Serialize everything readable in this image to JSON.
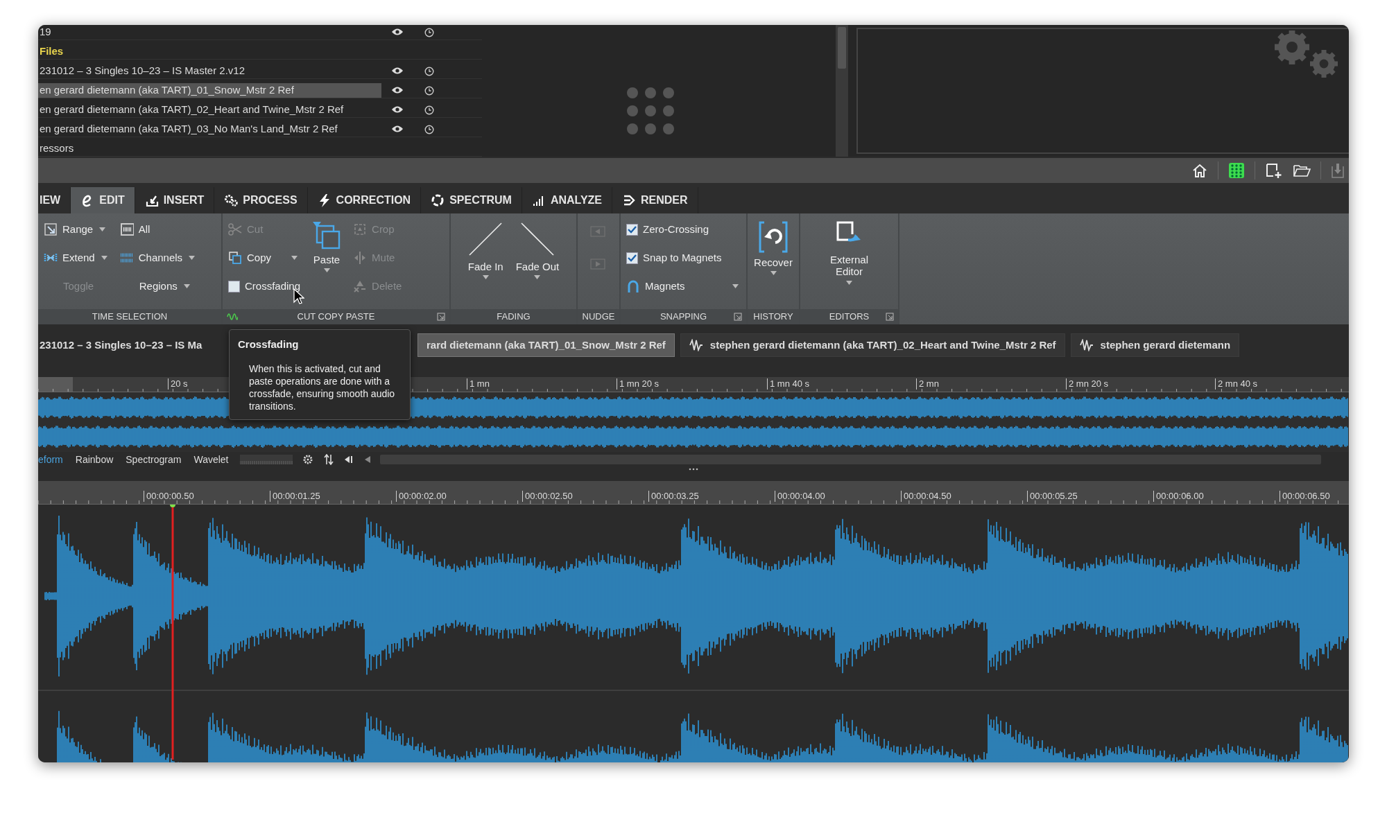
{
  "file_browser": {
    "rows": [
      {
        "kind": "file",
        "label": "19",
        "selected": false
      },
      {
        "kind": "heading",
        "label": "Files",
        "selected": false
      },
      {
        "kind": "file",
        "label": "231012 – 3 Singles 10–23 – IS Master 2.v12",
        "selected": false
      },
      {
        "kind": "file",
        "label": "en gerard dietemann (aka TART)_01_Snow_Mstr 2 Ref",
        "selected": true
      },
      {
        "kind": "file",
        "label": "en gerard dietemann (aka TART)_02_Heart and Twine_Mstr 2 Ref",
        "selected": false
      },
      {
        "kind": "file",
        "label": "en gerard dietemann (aka TART)_03_No Man's Land_Mstr 2 Ref",
        "selected": false
      },
      {
        "kind": "group",
        "label": "ressors",
        "selected": false
      }
    ]
  },
  "tabs": [
    {
      "label": "IEW",
      "selected": false
    },
    {
      "label": "EDIT",
      "selected": true
    },
    {
      "label": "INSERT",
      "selected": false
    },
    {
      "label": "PROCESS",
      "selected": false
    },
    {
      "label": "CORRECTION",
      "selected": false
    },
    {
      "label": "SPECTRUM",
      "selected": false
    },
    {
      "label": "ANALYZE",
      "selected": false
    },
    {
      "label": "RENDER",
      "selected": false
    }
  ],
  "ribbon": {
    "groups": [
      {
        "title": "TIME SELECTION",
        "columns": [
          [
            {
              "kind": "small",
              "label": "Range",
              "dropdown": true,
              "disabled": false
            },
            {
              "kind": "small",
              "label": "Extend",
              "dropdown": true,
              "disabled": false
            },
            {
              "kind": "small",
              "label": "Toggle",
              "dropdown": false,
              "disabled": true
            }
          ],
          [
            {
              "kind": "small",
              "label": "All",
              "dropdown": false,
              "disabled": false
            },
            {
              "kind": "small",
              "label": "Channels",
              "dropdown": true,
              "disabled": false
            },
            {
              "kind": "small",
              "label": "Regions",
              "dropdown": true,
              "disabled": false
            }
          ]
        ]
      },
      {
        "title": "CUT COPY PASTE",
        "columns": [
          [
            {
              "kind": "small",
              "label": "Cut",
              "dropdown": false,
              "disabled": true
            },
            {
              "kind": "small",
              "label": "Copy",
              "dropdown": true,
              "disabled": false
            },
            {
              "kind": "check",
              "label": "Crossfading",
              "checked": false
            }
          ],
          [
            {
              "kind": "large",
              "label": "Paste",
              "dropdown": true,
              "disabled": false
            }
          ],
          [
            {
              "kind": "small",
              "label": "Crop",
              "dropdown": false,
              "disabled": true
            },
            {
              "kind": "small",
              "label": "Mute",
              "dropdown": false,
              "disabled": true
            },
            {
              "kind": "small",
              "label": "Delete",
              "dropdown": false,
              "disabled": true
            }
          ]
        ]
      },
      {
        "title": "FADING",
        "columns": [
          [
            {
              "kind": "large",
              "label": "Fade In",
              "dropdown": true,
              "disabled": false
            }
          ],
          [
            {
              "kind": "large",
              "label": "Fade Out",
              "dropdown": true,
              "disabled": false
            }
          ]
        ]
      },
      {
        "title": "NUDGE",
        "columns": [
          [
            {
              "kind": "icon",
              "disabled": true
            },
            {
              "kind": "icon",
              "disabled": true
            }
          ]
        ]
      },
      {
        "title": "SNAPPING",
        "columns": [
          [
            {
              "kind": "check",
              "label": "Zero-Crossing",
              "checked": true
            },
            {
              "kind": "check",
              "label": "Snap to Magnets",
              "checked": true
            },
            {
              "kind": "small",
              "label": "Magnets",
              "dropdown": true,
              "disabled": false
            }
          ]
        ]
      },
      {
        "title": "HISTORY",
        "columns": [
          [
            {
              "kind": "large",
              "label": "Recover",
              "dropdown": true,
              "disabled": false
            }
          ]
        ]
      },
      {
        "title": "EDITORS",
        "columns": [
          [
            {
              "kind": "large",
              "label": "External Editor",
              "dropdown": true,
              "disabled": false
            }
          ]
        ]
      }
    ]
  },
  "file_tabs": [
    {
      "label": "231012 – 3 Singles 10–23 – IS Ma",
      "selected": false
    },
    {
      "label": "rard dietemann (aka TART)_01_Snow_Mstr 2 Ref",
      "selected": true
    },
    {
      "label": "stephen gerard dietemann (aka TART)_02_Heart and Twine_Mstr 2 Ref",
      "selected": false
    },
    {
      "label": "stephen gerard dietemann",
      "selected": false
    }
  ],
  "tooltip": {
    "title": "Crossfading",
    "text": "When this is activated, cut and paste operations are done with a crossfade, ensuring smooth audio transitions."
  },
  "overview": {
    "ruler_labels": [
      "20 s",
      "1 mn",
      "1 mn 20 s",
      "1 mn 40 s",
      "2 mn",
      "2 mn 20 s",
      "2 mn 40 s"
    ],
    "view_tabs": [
      {
        "label": "eform",
        "selected": true
      },
      {
        "label": "Rainbow",
        "selected": false
      },
      {
        "label": "Spectrogram",
        "selected": false
      },
      {
        "label": "Wavelet",
        "selected": false
      }
    ]
  },
  "detail": {
    "ruler_labels": [
      "00:00:00.50",
      "00:00:01.25",
      "00:00:02.00",
      "00:00:02.50",
      "00:00:03.25",
      "00:00:04.00",
      "00:00:04.50",
      "00:00:05.25",
      "00:00:06.00",
      "00:00:06.50"
    ]
  }
}
